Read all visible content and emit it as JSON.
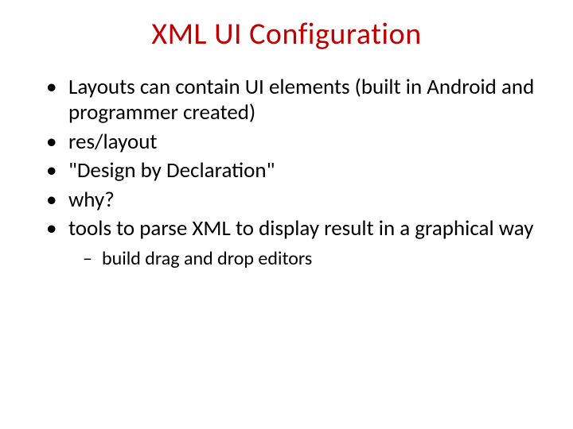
{
  "slide": {
    "title": "XML UI Configuration",
    "bullets": [
      "Layouts can contain UI elements (built in Android and programmer created)",
      "res/layout",
      "\"Design by Declaration\"",
      "why?",
      "tools to parse XML to display result in a graphical way"
    ],
    "sub_bullets": [
      "build drag and drop editors"
    ]
  }
}
